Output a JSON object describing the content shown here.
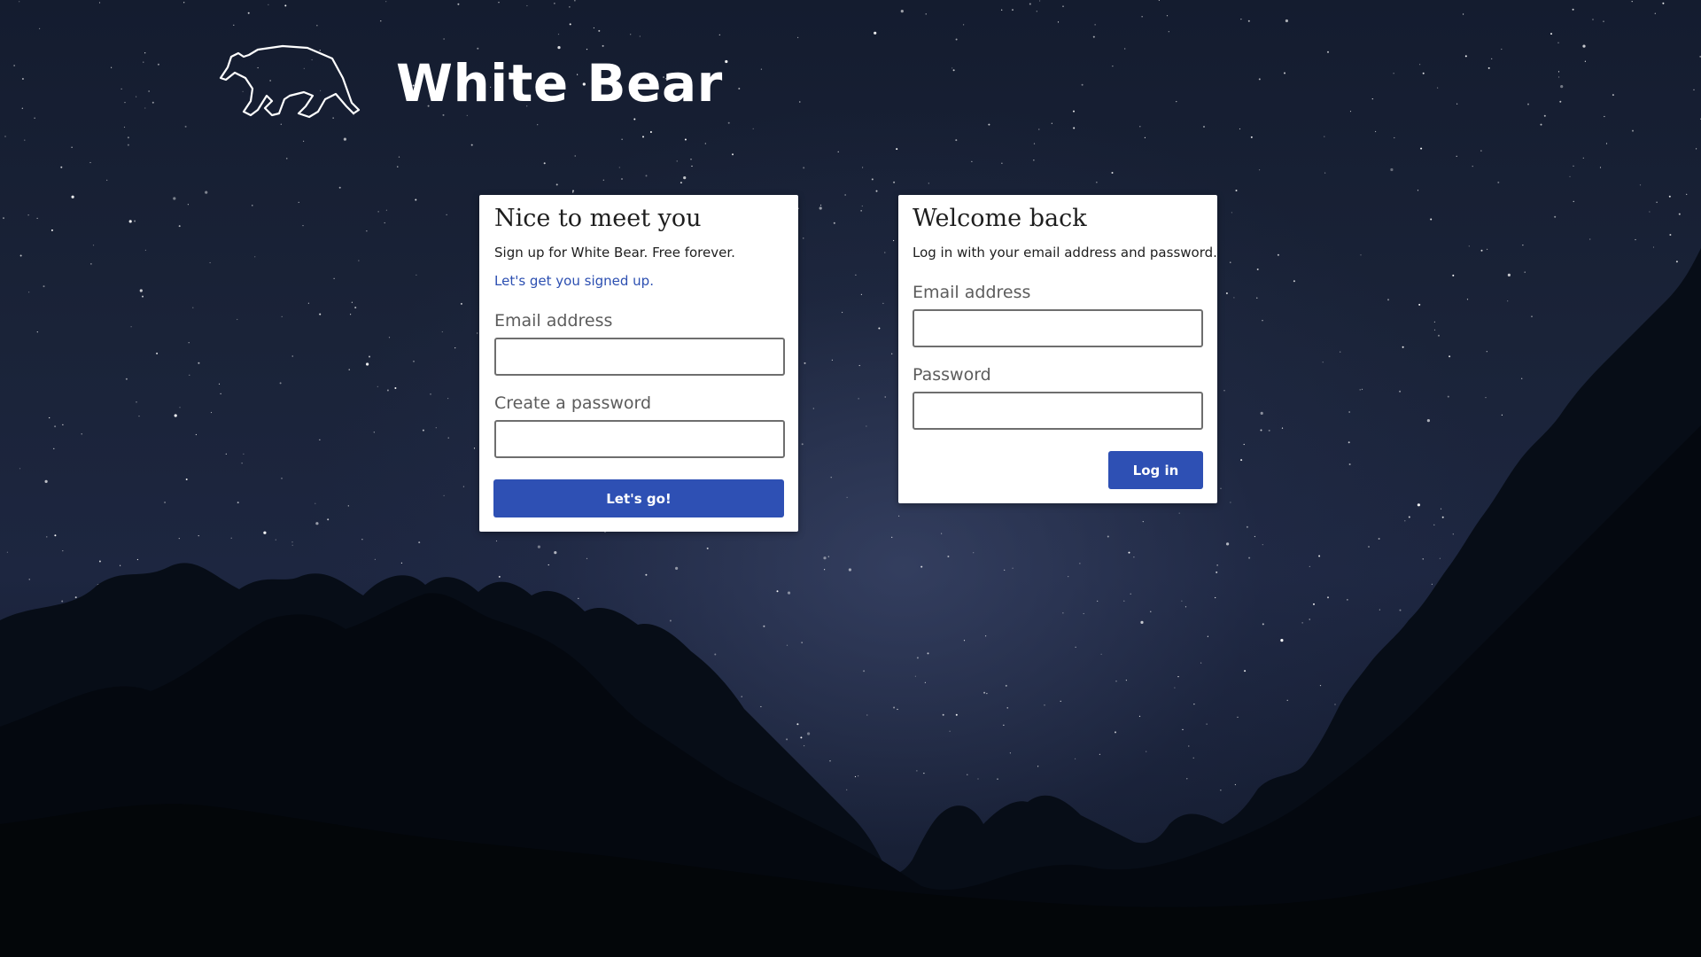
{
  "brand": {
    "title": "White Bear",
    "logo_icon": "bear-constellation-icon"
  },
  "signup": {
    "heading": "Nice to meet you",
    "subtitle": "Sign up for White Bear. Free forever.",
    "link_text": "Let's get you signed up.",
    "email_label": "Email address",
    "email_value": "",
    "password_label": "Create a password",
    "password_value": "",
    "submit_label": "Let's go!"
  },
  "login": {
    "heading": "Welcome back",
    "subtitle": "Log in with your email address and password.",
    "email_label": "Email address",
    "email_value": "",
    "password_label": "Password",
    "password_value": "",
    "submit_label": "Log in"
  },
  "colors": {
    "accent": "#2e50b4",
    "link": "#2c4fb1",
    "sky_dark": "#141c2f",
    "card_bg": "#ffffff"
  }
}
